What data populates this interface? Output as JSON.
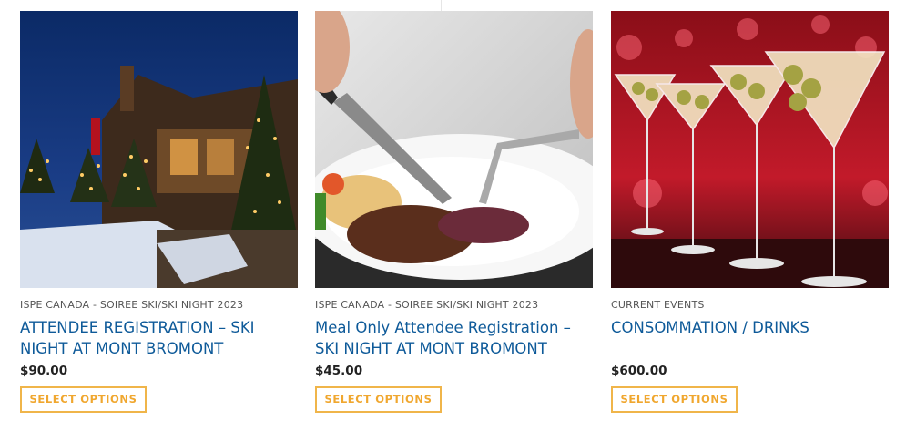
{
  "products": [
    {
      "category": "ISPE CANADA - SOIREE SKI/SKI NIGHT 2023",
      "title": "ATTENDEE REGISTRATION – SKI NIGHT AT MONT BROMONT",
      "price": "$90.00",
      "button_label": "SELECT OPTIONS",
      "image_icon": "ski-lodge-night-image"
    },
    {
      "category": "ISPE CANADA - SOIREE SKI/SKI NIGHT 2023",
      "title": "Meal Only Attendee Registration – SKI NIGHT AT MONT BROMONT",
      "price": "$45.00",
      "button_label": "SELECT OPTIONS",
      "image_icon": "meal-plate-image"
    },
    {
      "category": "CURRENT EVENTS",
      "title": "CONSOMMATION / DRINKS",
      "price": "$600.00",
      "button_label": "SELECT OPTIONS",
      "image_icon": "martini-glasses-image"
    }
  ],
  "colors": {
    "title_link": "#0e5a99",
    "button_border": "#f0b54a",
    "button_text": "#f0a72f"
  }
}
